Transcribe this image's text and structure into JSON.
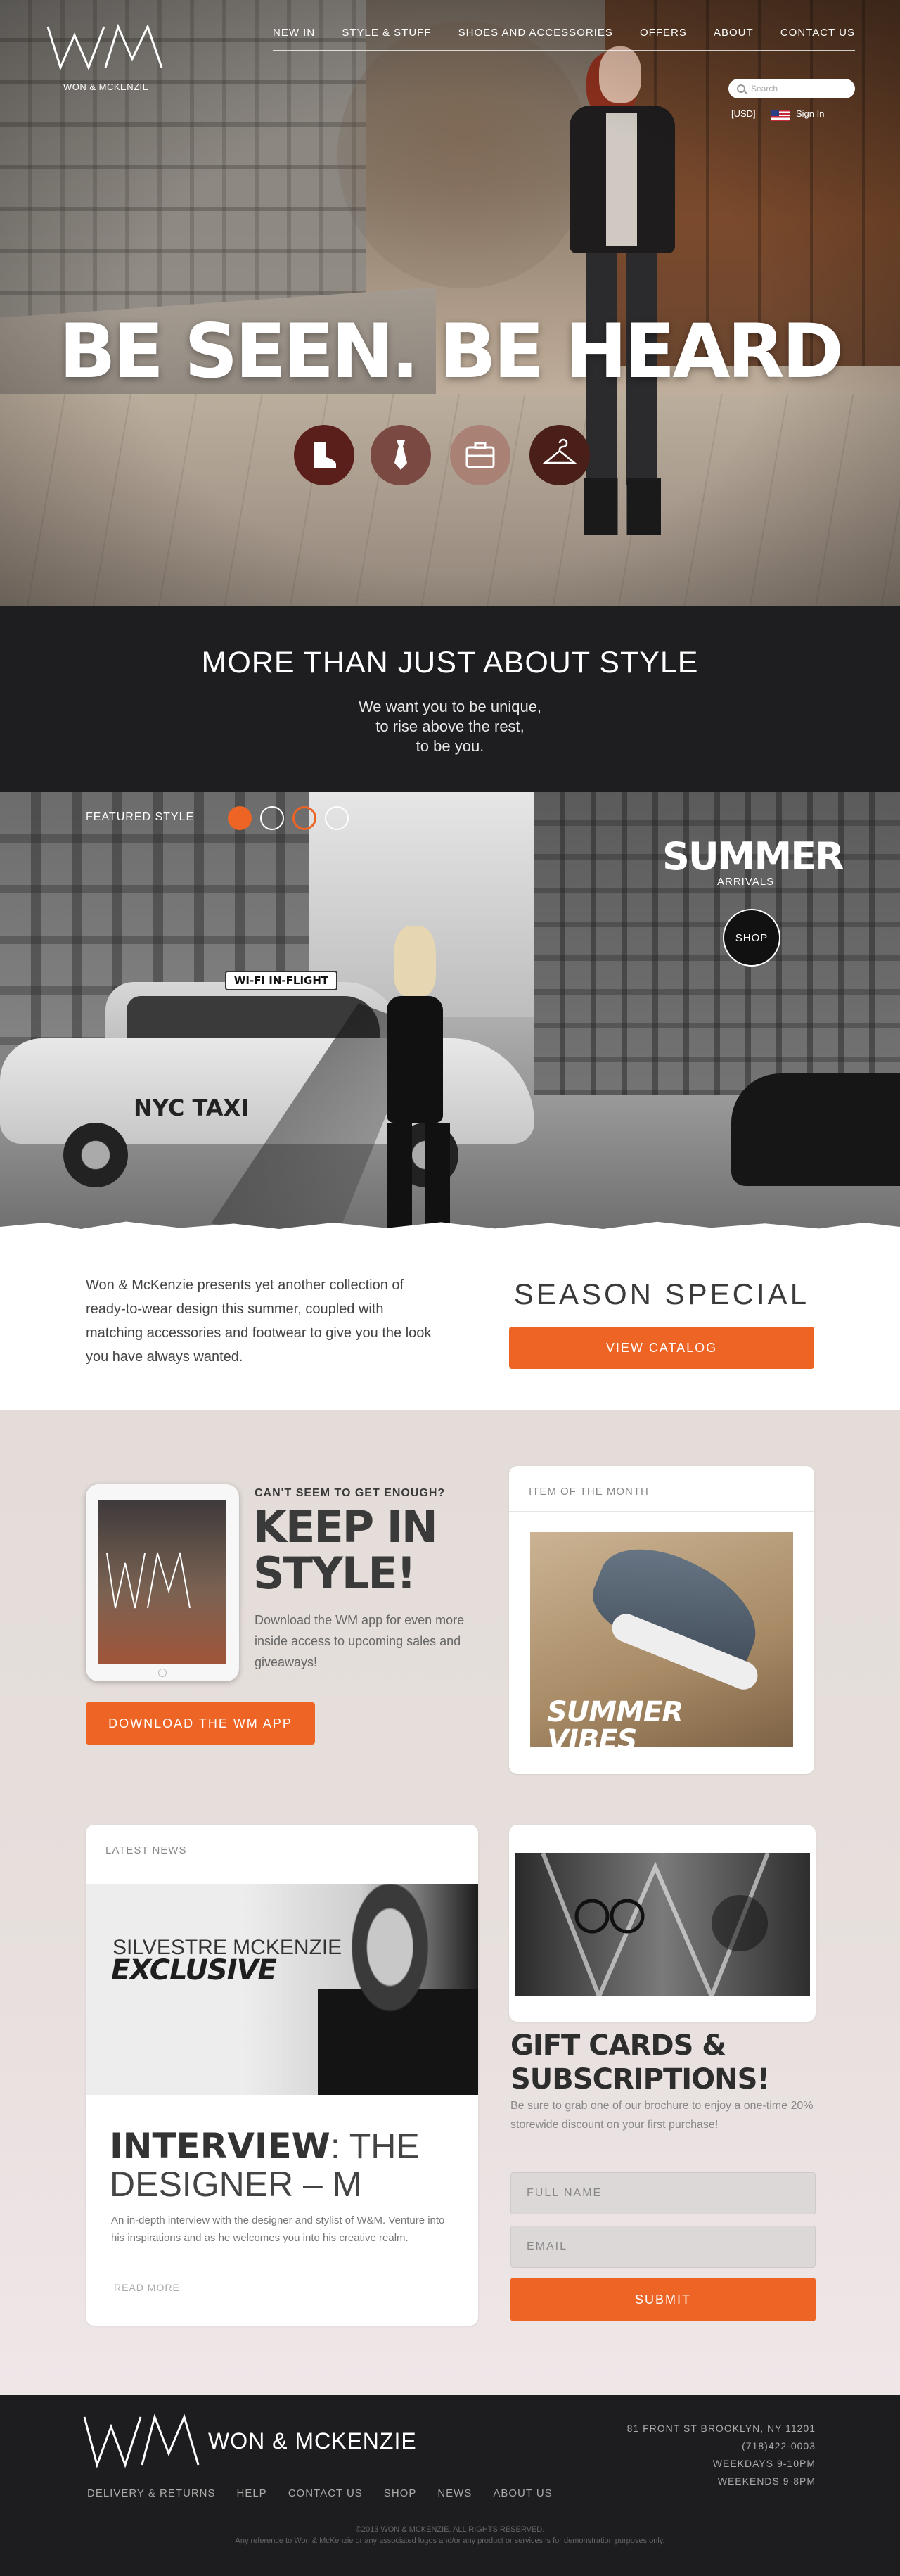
{
  "brand": {
    "logo_text": "WON & MCKENZIE",
    "footer_name": "WON & MCKENZIE"
  },
  "nav": {
    "items": [
      {
        "label": "NEW IN"
      },
      {
        "label": "STYLE & STUFF"
      },
      {
        "label": "SHOES AND ACCESSORIES"
      },
      {
        "label": "OFFERS"
      },
      {
        "label": "ABOUT"
      },
      {
        "label": "CONTACT US"
      }
    ]
  },
  "search": {
    "placeholder": "Search"
  },
  "account": {
    "currency": "[USD]",
    "signin": "Sign In"
  },
  "hero": {
    "headline": "BE SEEN. BE HEARD",
    "icons": [
      {
        "name": "boot-icon",
        "color": "#5a1f1a"
      },
      {
        "name": "tie-icon",
        "color": "#7a4a42"
      },
      {
        "name": "briefcase-icon",
        "color": "#a98175"
      },
      {
        "name": "hanger-icon",
        "color": "#4a1f1a"
      }
    ]
  },
  "tagline": {
    "title": "MORE THAN JUST ABOUT STYLE",
    "lines": [
      "We want you to be unique,",
      "to rise above the rest,",
      "to be you."
    ]
  },
  "featured": {
    "label": "FEATURED STYLE",
    "taxi_sign": "WI-FI IN-FLIGHT",
    "taxi_text": "NYC TAXI",
    "promo_title": "SUMMER",
    "promo_sub": "ARRIVALS",
    "shop_label": "SHOP"
  },
  "season": {
    "description": "Won & McKenzie presents yet another collection of ready-to-wear design this summer, coupled with matching accessories and footwear to give you the look you have always wanted.",
    "title": "SEASON SPECIAL",
    "button": "VIEW CATALOG"
  },
  "app_promo": {
    "kicker": "CAN'T SEEM TO GET ENOUGH?",
    "title": "KEEP IN STYLE!",
    "description": "Download the WM app for even more inside access to upcoming sales and giveaways!",
    "button": "DOWNLOAD THE WM APP"
  },
  "item_of_month": {
    "label": "ITEM OF THE MONTH",
    "caption_line1": "SUMMER",
    "caption_line2": "VIBES"
  },
  "news": {
    "label": "LATEST NEWS",
    "photo_kicker": "SILVESTRE MCKENZIE",
    "photo_title": "EXCLUSIVE",
    "title_bold": "INTERVIEW",
    "title_rest": ": THE DESIGNER – M",
    "description": "An in-depth interview with the designer and stylist of W&M. Venture into his inspirations and as he welcomes you into his creative realm.",
    "read_more": "READ MORE"
  },
  "gift": {
    "title": "GIFT CARDS & SUBSCRIPTIONS!",
    "description": "Be sure to grab one of our brochure to enjoy a one-time 20% storewide discount on your first purchase!",
    "name_placeholder": "FULL NAME",
    "email_placeholder": "EMAIL",
    "submit": "SUBMIT"
  },
  "footer": {
    "address": [
      "81 FRONT ST BROOKLYN, NY 11201",
      "(718)422-0003",
      "WEEKDAYS 9-10PM",
      "WEEKENDS 9-8PM"
    ],
    "links": [
      {
        "label": "DELIVERY & RETURNS"
      },
      {
        "label": "HELP"
      },
      {
        "label": "CONTACT US"
      },
      {
        "label": "SHOP"
      },
      {
        "label": "NEWS"
      },
      {
        "label": "ABOUT US"
      }
    ],
    "legal": [
      "©2013 WON & MCKENZIE. ALL RIGHTS RESERVED.",
      "Any reference to Won & McKenzie or any associated logos and/or any product or services is for demonstration purposes only."
    ]
  },
  "colors": {
    "accent": "#ee6424",
    "dark": "#1e1d1f",
    "panel": "#e3dcd8"
  }
}
